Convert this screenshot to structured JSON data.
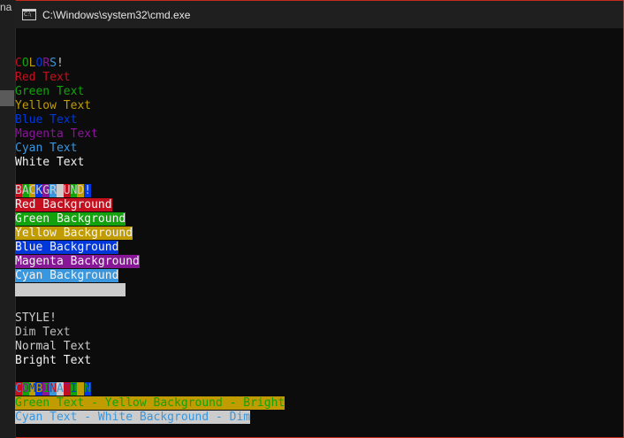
{
  "window": {
    "title": "C:\\Windows\\system32\\cmd.exe",
    "left_fragment": "na"
  },
  "colors": {
    "black": "#0c0c0c",
    "red": "#c50f1f",
    "green": "#13a10e",
    "yellow": "#c19c00",
    "blue": "#0037da",
    "magenta": "#881798",
    "cyan": "#3a96dd",
    "white": "#cccccc",
    "bright_white": "#f2f2f2",
    "dim_gray": "#bbbbbb",
    "frame": "#c42b1c"
  },
  "console": {
    "lines": [
      {
        "segments": [
          {
            "text": "C",
            "fg": "#c50f1f"
          },
          {
            "text": "O",
            "fg": "#13a10e"
          },
          {
            "text": "L",
            "fg": "#c19c00"
          },
          {
            "text": "O",
            "fg": "#0037da"
          },
          {
            "text": "R",
            "fg": "#881798"
          },
          {
            "text": "S",
            "fg": "#3a96dd"
          },
          {
            "text": "!",
            "fg": "#cccccc"
          }
        ]
      },
      {
        "segments": [
          {
            "text": "Red Text",
            "fg": "#c50f1f"
          }
        ]
      },
      {
        "segments": [
          {
            "text": "Green Text",
            "fg": "#13a10e"
          }
        ]
      },
      {
        "segments": [
          {
            "text": "Yellow Text",
            "fg": "#c19c00"
          }
        ]
      },
      {
        "segments": [
          {
            "text": "Blue Text",
            "fg": "#0037da"
          }
        ]
      },
      {
        "segments": [
          {
            "text": "Magenta Text",
            "fg": "#881798"
          }
        ]
      },
      {
        "segments": [
          {
            "text": "Cyan Text",
            "fg": "#3a96dd"
          }
        ]
      },
      {
        "segments": [
          {
            "text": "White Text",
            "fg": "#f2f2f2"
          }
        ]
      },
      {
        "segments": []
      },
      {
        "segments": [
          {
            "text": "B",
            "fg": "#cccccc",
            "bg": "#c50f1f"
          },
          {
            "text": "A",
            "fg": "#cccccc",
            "bg": "#13a10e"
          },
          {
            "text": "C",
            "fg": "#cccccc",
            "bg": "#c19c00"
          },
          {
            "text": "K",
            "fg": "#cccccc",
            "bg": "#0037da"
          },
          {
            "text": "G",
            "fg": "#cccccc",
            "bg": "#881798"
          },
          {
            "text": "R",
            "fg": "#cccccc",
            "bg": "#3a96dd"
          },
          {
            "text": " ",
            "fg": "#cccccc",
            "bg": "#cccccc"
          },
          {
            "text": "U",
            "fg": "#cccccc",
            "bg": "#c50f1f"
          },
          {
            "text": "N",
            "fg": "#cccccc",
            "bg": "#13a10e"
          },
          {
            "text": "D",
            "fg": "#cccccc",
            "bg": "#c19c00"
          },
          {
            "text": "!",
            "fg": "#cccccc",
            "bg": "#0037da"
          }
        ]
      },
      {
        "segments": [
          {
            "text": "Red Background",
            "fg": "#f2f2f2",
            "bg": "#c50f1f"
          }
        ]
      },
      {
        "segments": [
          {
            "text": "Green Background",
            "fg": "#f2f2f2",
            "bg": "#13a10e"
          }
        ]
      },
      {
        "segments": [
          {
            "text": "Yellow Background",
            "fg": "#f2f2f2",
            "bg": "#c19c00"
          }
        ]
      },
      {
        "segments": [
          {
            "text": "Blue Background",
            "fg": "#f2f2f2",
            "bg": "#0037da"
          }
        ]
      },
      {
        "segments": [
          {
            "text": "Magenta Background",
            "fg": "#f2f2f2",
            "bg": "#881798"
          }
        ]
      },
      {
        "segments": [
          {
            "text": "Cyan Background",
            "fg": "#f2f2f2",
            "bg": "#3a96dd"
          }
        ]
      },
      {
        "segments": [
          {
            "text": "                ",
            "fg": "#cccccc",
            "bg": "#cccccc"
          }
        ]
      },
      {
        "segments": []
      },
      {
        "segments": [
          {
            "text": "STYLE!",
            "fg": "#cccccc"
          }
        ]
      },
      {
        "segments": [
          {
            "text": "Dim Text",
            "fg": "#bbbbbb"
          }
        ]
      },
      {
        "segments": [
          {
            "text": "Normal Text",
            "fg": "#cccccc"
          }
        ]
      },
      {
        "segments": [
          {
            "text": "Bright Text",
            "fg": "#f2f2f2"
          }
        ]
      },
      {
        "segments": []
      },
      {
        "segments": [
          {
            "text": "C",
            "fg": "#3a96dd",
            "bg": "#c50f1f"
          },
          {
            "text": "O",
            "fg": "#881798",
            "bg": "#13a10e"
          },
          {
            "text": "M",
            "fg": "#0037da",
            "bg": "#c19c00"
          },
          {
            "text": "B",
            "fg": "#c19c00",
            "bg": "#0037da"
          },
          {
            "text": "I",
            "fg": "#13a10e",
            "bg": "#881798"
          },
          {
            "text": "N",
            "fg": "#c50f1f",
            "bg": "#3a96dd"
          },
          {
            "text": "A",
            "fg": "#3a96dd",
            "bg": "#cccccc"
          },
          {
            "text": "T",
            "fg": "#881798",
            "bg": "#c50f1f"
          },
          {
            "text": "I",
            "fg": "#0037da",
            "bg": "#13a10e"
          },
          {
            "text": "O",
            "fg": "#c19c00",
            "bg": "#c19c00"
          },
          {
            "text": "N",
            "fg": "#13a10e",
            "bg": "#0037da"
          }
        ]
      },
      {
        "segments": [
          {
            "text": "Green Text - Yellow Background - Bright",
            "fg": "#13a10e",
            "bg": "#c19c00"
          }
        ]
      },
      {
        "segments": [
          {
            "text": "Cyan Text - White Background - Dim",
            "fg": "#3a96dd",
            "bg": "#cccccc"
          }
        ]
      }
    ]
  }
}
